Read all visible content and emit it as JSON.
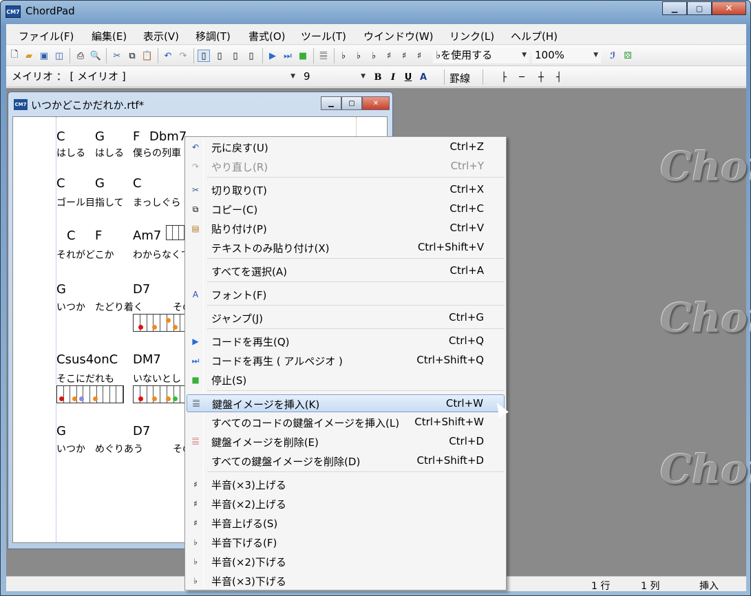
{
  "app": {
    "title": "ChordPad",
    "icon_text": "CM7"
  },
  "menubar": [
    "ファイル(F)",
    "編集(E)",
    "表示(V)",
    "移調(T)",
    "書式(O)",
    "ツール(T)",
    "ウインドウ(W)",
    "リンク(L)",
    "ヘルプ(H)"
  ],
  "toolbar": {
    "flat_combo": "♭を使用する",
    "zoom": "100%"
  },
  "format_bar": {
    "font": "メイリオ ： [ メイリオ ]",
    "size": "9",
    "bold": "B",
    "italic": "I",
    "underline": "U",
    "ruled": "罫線"
  },
  "watermark": "ChordPad",
  "document": {
    "title": "いつかどこかだれか.rtf*",
    "lines": [
      {
        "chords": [
          "C",
          "G",
          "F",
          "Dbm7"
        ],
        "lyrics": [
          "はしる",
          "はしる",
          "僕らの列車"
        ]
      },
      {
        "chords": [
          "C",
          "G",
          "C"
        ],
        "lyrics": [
          "ゴール目指して",
          "まっしぐら"
        ]
      },
      {
        "chords": [
          "C",
          "F",
          "Am7"
        ],
        "lyrics": [
          "それがどこか",
          "わからなくて"
        ]
      },
      {
        "chords": [
          "G",
          "D7"
        ],
        "lyrics": [
          "いつか",
          "たどり着く",
          "その"
        ]
      },
      {
        "chords": [
          "Csus4onC",
          "DM7"
        ],
        "lyrics": [
          "そこにだれも",
          "いないとし"
        ]
      },
      {
        "chords": [
          "G",
          "D7"
        ],
        "lyrics": [
          "いつか",
          "めぐりあう",
          "その"
        ]
      }
    ]
  },
  "context_menu": [
    {
      "label": "元に戻す(U)",
      "shortcut": "Ctrl+Z",
      "icon": "undo-icon",
      "disabled": false
    },
    {
      "label": "やり直し(R)",
      "shortcut": "Ctrl+Y",
      "icon": "redo-icon",
      "disabled": true
    },
    {
      "label": "切り取り(T)",
      "shortcut": "Ctrl+X",
      "icon": "cut-icon",
      "disabled": false
    },
    {
      "label": "コピー(C)",
      "shortcut": "Ctrl+C",
      "icon": "copy-icon",
      "disabled": false
    },
    {
      "label": "貼り付け(P)",
      "shortcut": "Ctrl+V",
      "icon": "paste-icon",
      "disabled": false
    },
    {
      "label": "テキストのみ貼り付け(X)",
      "shortcut": "Ctrl+Shift+V",
      "icon": "",
      "disabled": false
    },
    {
      "label": "すべてを選択(A)",
      "shortcut": "Ctrl+A",
      "icon": "",
      "disabled": false
    },
    {
      "label": "フォント(F)",
      "shortcut": "",
      "icon": "font-icon",
      "disabled": false
    },
    {
      "label": "ジャンプ(J)",
      "shortcut": "Ctrl+G",
      "icon": "",
      "disabled": false
    },
    {
      "label": "コードを再生(Q)",
      "shortcut": "Ctrl+Q",
      "icon": "play-icon",
      "disabled": false
    },
    {
      "label": "コードを再生 ( アルペジオ )",
      "shortcut": "Ctrl+Shift+Q",
      "icon": "play-arpeggio-icon",
      "disabled": false
    },
    {
      "label": "停止(S)",
      "shortcut": "",
      "icon": "stop-icon",
      "disabled": false
    },
    {
      "label": "鍵盤イメージを挿入(K)",
      "shortcut": "Ctrl+W",
      "icon": "keyboard-icon",
      "disabled": false,
      "highlighted": true
    },
    {
      "label": "すべてのコードの鍵盤イメージを挿入(L)",
      "shortcut": "Ctrl+Shift+W",
      "icon": "",
      "disabled": false
    },
    {
      "label": "鍵盤イメージを削除(E)",
      "shortcut": "Ctrl+D",
      "icon": "keyboard-delete-icon",
      "disabled": false
    },
    {
      "label": "すべての鍵盤イメージを削除(D)",
      "shortcut": "Ctrl+Shift+D",
      "icon": "",
      "disabled": false
    },
    {
      "label": "半音(×3)上げる",
      "shortcut": "",
      "icon": "sharp3-icon",
      "disabled": false
    },
    {
      "label": "半音(×2)上げる",
      "shortcut": "",
      "icon": "sharp2-icon",
      "disabled": false
    },
    {
      "label": "半音上げる(S)",
      "shortcut": "",
      "icon": "sharp-icon",
      "disabled": false
    },
    {
      "label": "半音下げる(F)",
      "shortcut": "",
      "icon": "flat-icon",
      "disabled": false
    },
    {
      "label": "半音(×2)下げる",
      "shortcut": "",
      "icon": "flat2-icon",
      "disabled": false
    },
    {
      "label": "半音(×3)下げる",
      "shortcut": "",
      "icon": "flat3-icon",
      "disabled": false
    }
  ],
  "status": {
    "line": "1 行",
    "col": "1 列",
    "mode": "挿入"
  }
}
